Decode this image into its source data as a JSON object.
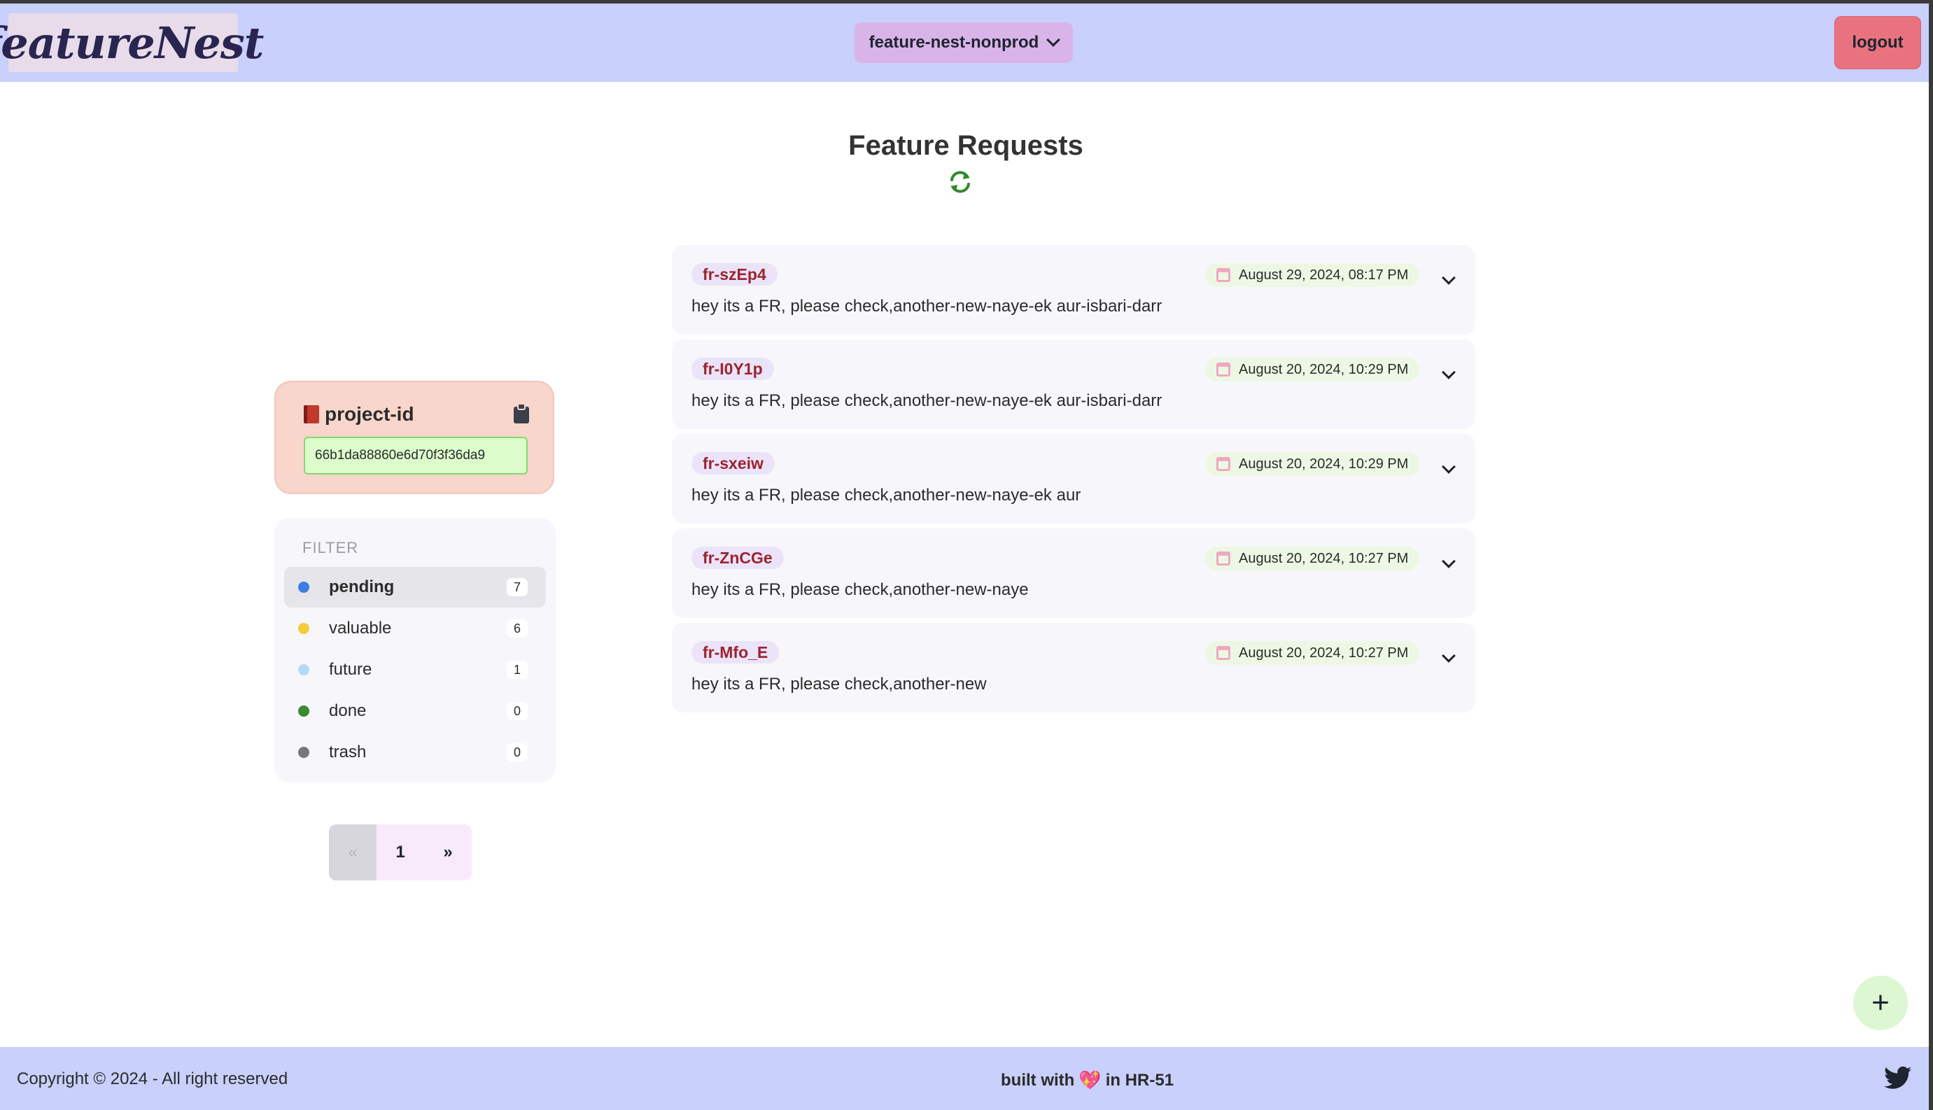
{
  "navbar": {
    "logo_text": "featureNest",
    "project_select": "feature-nest-nonprod",
    "logout_label": "logout"
  },
  "main": {
    "title": "Feature Requests"
  },
  "project_card": {
    "title": "project-id",
    "id_value": "66b1da88860e6d70f3f36da9"
  },
  "filter": {
    "label": "FILTER",
    "items": [
      {
        "name": "pending",
        "count": "7",
        "color": "#3b7fe0"
      },
      {
        "name": "valuable",
        "count": "6",
        "color": "#f2cc3a"
      },
      {
        "name": "future",
        "count": "1",
        "color": "#b5d8f5"
      },
      {
        "name": "done",
        "count": "0",
        "color": "#3a8a2e"
      },
      {
        "name": "trash",
        "count": "0",
        "color": "#777777"
      }
    ]
  },
  "pagination": {
    "prev": "«",
    "current": "1",
    "next": "»"
  },
  "feature_requests": [
    {
      "id": "fr-szEp4",
      "date": "August 29, 2024, 08:17 PM",
      "text": "hey its a FR, please check,another-new-naye-ek aur-isbari-darr"
    },
    {
      "id": "fr-I0Y1p",
      "date": "August 20, 2024, 10:29 PM",
      "text": "hey its a FR, please check,another-new-naye-ek aur-isbari-darr"
    },
    {
      "id": "fr-sxeiw",
      "date": "August 20, 2024, 10:29 PM",
      "text": "hey its a FR, please check,another-new-naye-ek aur"
    },
    {
      "id": "fr-ZnCGe",
      "date": "August 20, 2024, 10:27 PM",
      "text": "hey its a FR, please check,another-new-naye"
    },
    {
      "id": "fr-Mfo_E",
      "date": "August 20, 2024, 10:27 PM",
      "text": "hey its a FR, please check,another-new"
    }
  ],
  "fab": {
    "label": "+"
  },
  "footer": {
    "copyright": "Copyright © 2024 - All right reserved",
    "built_prefix": "built with",
    "built_heart": "💖",
    "built_suffix": "in HR-51"
  },
  "icons": [
    "refresh-icon",
    "book-icon",
    "clipboard-icon",
    "chevron-down-icon",
    "calendar-icon",
    "plus-icon",
    "twitter-icon"
  ]
}
